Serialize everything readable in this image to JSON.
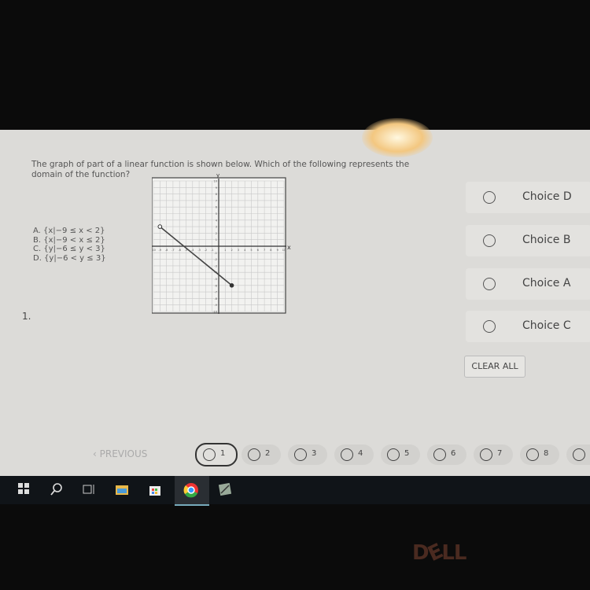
{
  "question": {
    "number": "1.",
    "text": "The graph of part of a linear function is shown below. Which of the following represents the domain of the function?",
    "options": [
      "A.  {x|−9 ≤ x < 2}",
      "B.  {x|−9 < x ≤ 2}",
      "C.  {y|−6 ≤ y < 3}",
      "D.  {y|−6 < y ≤ 3}"
    ]
  },
  "graph": {
    "x_label": "x",
    "y_label": "y",
    "range": [
      -10,
      10
    ],
    "segment": {
      "start": [
        -9,
        3
      ],
      "start_open": true,
      "end": [
        2,
        -6
      ],
      "end_open": false
    }
  },
  "choices": [
    "Choice D",
    "Choice B",
    "Choice A",
    "Choice C"
  ],
  "clear_all": "CLEAR ALL",
  "previous": "‹  PREVIOUS",
  "pages": [
    "1",
    "2",
    "3",
    "4",
    "5",
    "6",
    "7",
    "8"
  ],
  "current_page": "1",
  "taskbar": [
    "windows-start-icon",
    "search-icon",
    "task-view-icon",
    "file-explorer-icon",
    "store-icon",
    "chrome-icon",
    "app-icon"
  ],
  "brand": "DELL"
}
